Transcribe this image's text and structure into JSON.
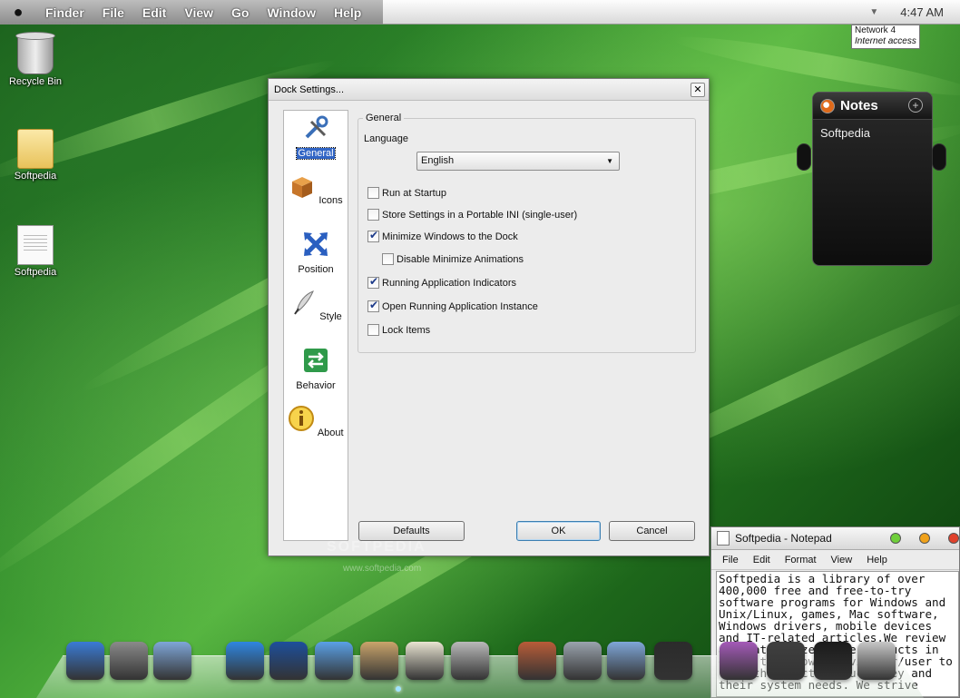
{
  "menubar": {
    "items": [
      "Finder",
      "File",
      "Edit",
      "View",
      "Go",
      "Window",
      "Help"
    ],
    "clock": "4:47 AM",
    "network": {
      "title": "Network  4",
      "status": "Internet access"
    }
  },
  "desktop_icons": [
    {
      "label": "Recycle Bin",
      "icon": "recycle-bin-icon"
    },
    {
      "label": "Softpedia",
      "icon": "folder-icon"
    },
    {
      "label": "Softpedia",
      "icon": "text-document-icon"
    }
  ],
  "dialog": {
    "title": "Dock Settings...",
    "close": "✕",
    "sidebar": [
      {
        "label": "General",
        "icon": "tools-icon",
        "selected": true
      },
      {
        "label": "Icons",
        "icon": "box-icon"
      },
      {
        "label": "Position",
        "icon": "arrows-icon"
      },
      {
        "label": "Style",
        "icon": "quill-icon"
      },
      {
        "label": "Behavior",
        "icon": "switch-arrows-icon"
      },
      {
        "label": "About",
        "icon": "info-icon"
      }
    ],
    "group_title": "General",
    "language_label": "Language",
    "language_value": "English",
    "options": [
      {
        "label": "Run at Startup",
        "checked": false
      },
      {
        "label": "Store Settings in a Portable INI (single-user)",
        "checked": false
      },
      {
        "label": "Minimize Windows to the Dock",
        "checked": true
      },
      {
        "label": "Disable Minimize Animations",
        "checked": false
      },
      {
        "label": "Running Application Indicators",
        "checked": true
      },
      {
        "label": "Open Running Application Instance",
        "checked": true
      },
      {
        "label": "Lock Items",
        "checked": false
      }
    ],
    "buttons": {
      "defaults": "Defaults",
      "ok": "OK",
      "cancel": "Cancel"
    }
  },
  "notes_widget": {
    "title": "Notes",
    "add": "+",
    "text": "Softpedia"
  },
  "notepad": {
    "title": "Softpedia - Notepad",
    "menu": [
      "File",
      "Edit",
      "Format",
      "View",
      "Help"
    ],
    "text": "Softpedia is a library of over 400,000 free and free-to-try software programs for Windows and Unix/Linux, games, Mac software, Windows drivers, mobile devices and IT-related articles.We review and categorize these products in order to allow the visitor/user to find the exact product they and their system needs. We strive",
    "button_colors": {
      "minimize": "#6fcf3a",
      "maximize": "#f0a21b",
      "close": "#e0412c"
    }
  },
  "watermark": {
    "brand": "SOFTPEDIA",
    "url": "www.softpedia.com"
  },
  "dock": {
    "icons": [
      {
        "name": "finder-icon",
        "color": "#3a7bd5"
      },
      {
        "name": "system-preferences-icon",
        "color": "#8a8a8a"
      },
      {
        "name": "users-folder-icon",
        "color": "#7fa6d8"
      },
      {
        "name": "safari-icon",
        "color": "#2f86e0"
      },
      {
        "name": "quicktime-icon",
        "color": "#1d4f9b"
      },
      {
        "name": "mail-icon",
        "color": "#5aa0e6"
      },
      {
        "name": "iphoto-icon",
        "color": "#c9a46b"
      },
      {
        "name": "textedit-icon",
        "color": "#e9e4d2"
      },
      {
        "name": "calculator-icon",
        "color": "#b9b9b9"
      },
      {
        "name": "app-store-icon",
        "color": "#b85c38"
      },
      {
        "name": "boot-camp-icon",
        "color": "#9aa3ad"
      },
      {
        "name": "library-folder-icon",
        "color": "#7fa6d8"
      },
      {
        "name": "media-icon",
        "color": "#2b2b2b"
      },
      {
        "name": "photo-strip-icon",
        "color": "#a45ab8"
      },
      {
        "name": "rocket-icon",
        "color": "#3f3f3f"
      },
      {
        "name": "power-icon",
        "color": "#1b1b1b"
      },
      {
        "name": "trash-icon",
        "color": "#c7c7c7"
      }
    ]
  }
}
